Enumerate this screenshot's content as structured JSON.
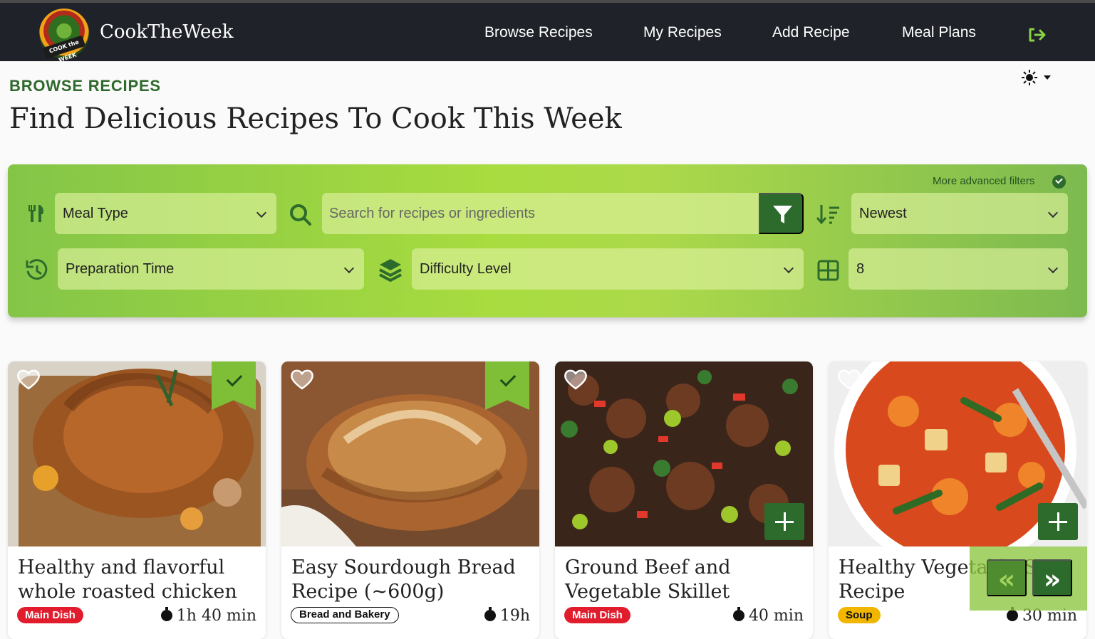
{
  "brand": {
    "name": "CookTheWeek",
    "logo_text": "COOK the WEEK"
  },
  "nav": {
    "browse": "Browse Recipes",
    "my": "My Recipes",
    "add": "Add Recipe",
    "plans": "Meal Plans"
  },
  "page": {
    "eyebrow": "BROWSE RECIPES",
    "title": "Find Delicious Recipes To Cook This Week"
  },
  "filters": {
    "advanced_label": "More advanced filters",
    "meal_type": "Meal Type",
    "search_placeholder": "Search for recipes or ingredients",
    "sort": "Newest",
    "prep_time": "Preparation Time",
    "difficulty": "Difficulty Level",
    "per_page": "8"
  },
  "recipes": [
    {
      "title": "Healthy and flavorful whole roasted chicken",
      "category": "Main Dish",
      "time": "1h 40 min",
      "added": true
    },
    {
      "title": "Easy Sourdough Bread Recipe (~600g)",
      "category": "Bread and Bakery",
      "time": "19h",
      "added": true
    },
    {
      "title": "Ground Beef and Vegetable Skillet",
      "category": "Main Dish",
      "time": "40 min",
      "added": false
    },
    {
      "title": "Healthy Vegetable Soup Recipe",
      "category": "Soup",
      "time": "30 min",
      "added": false
    }
  ],
  "pager": {
    "prev": "«",
    "next": "»"
  },
  "colors": {
    "header": "#1f2228",
    "accent": "#2d6b2c",
    "filter_green": "#a8dc3f",
    "main_dish": "#e11d2d",
    "soup": "#f0b600"
  }
}
